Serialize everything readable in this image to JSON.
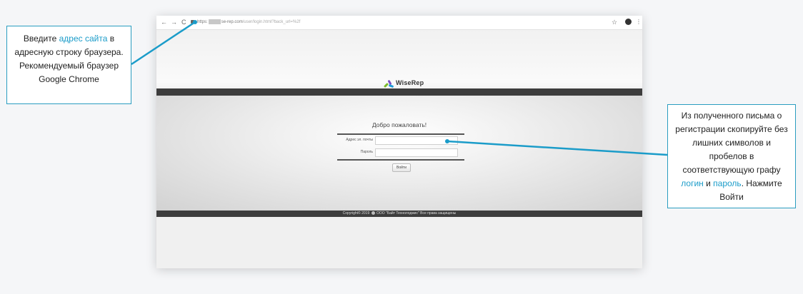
{
  "browser": {
    "nav_back": "←",
    "nav_forward": "→",
    "nav_reload": "C",
    "url_prefix": "https:",
    "url_domain": "se-rep.com",
    "url_path": "/user/login.html?back_url=%2f",
    "star": "☆",
    "menu": "⋮"
  },
  "site": {
    "logo_text": "WiseRep",
    "welcome": "Добро пожаловать!",
    "email_label": "Адрес эл. почты",
    "password_label": "Пароль",
    "login_button": "Войти",
    "footer_before": "Copyright© 2019",
    "footer_after": "ООО \"Байт Технолоджис\" Все права защищены"
  },
  "callout_left": {
    "t1": "Введите ",
    "link": "адрес сайта",
    "t2": " в адресную строку браузера. Рекомендуемый браузер Google Chrome"
  },
  "callout_right": {
    "t1": "Из полученного письма о регистрации скопируйте без лишних символов и пробелов в соответствующую графу ",
    "link_login": "логин",
    "t2": " и ",
    "link_password": "пароль",
    "t3": ". Нажмите Войти"
  },
  "colors": {
    "accent": "#1b9cc9",
    "dark_bar": "#3d3d3d"
  }
}
